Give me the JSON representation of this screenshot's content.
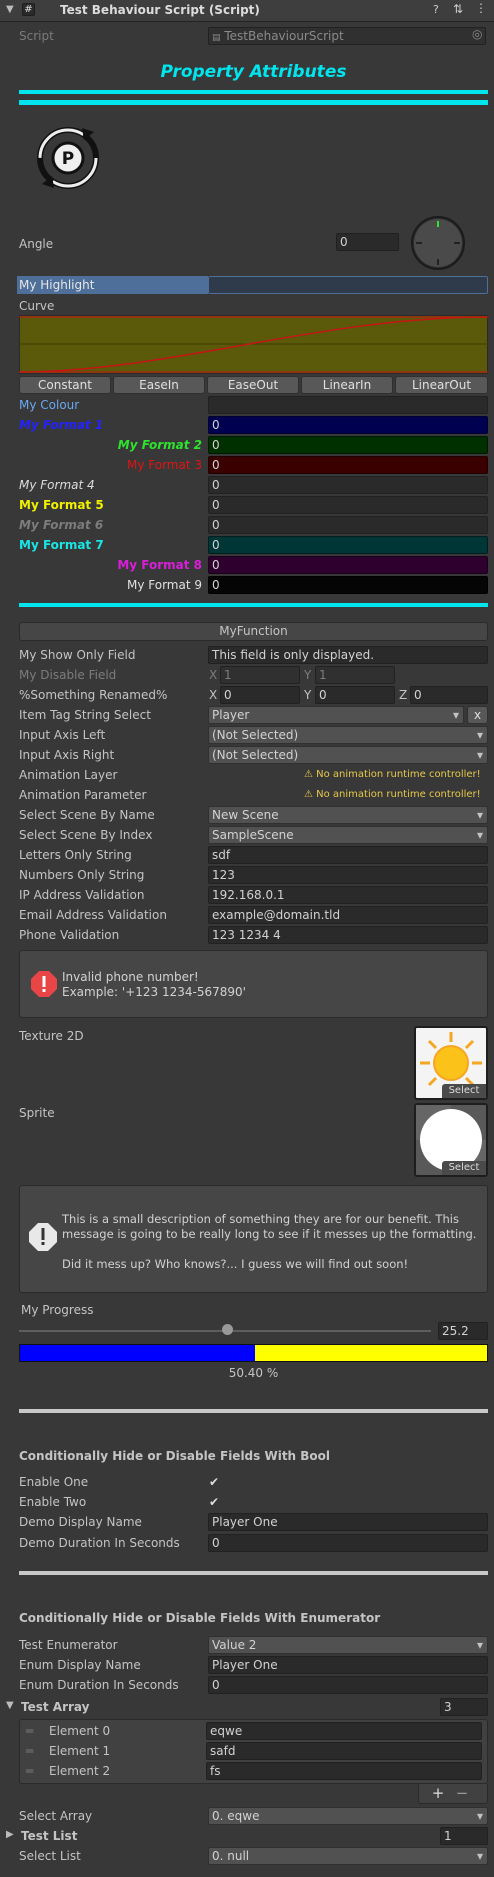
{
  "header": {
    "title": "Test Behaviour Script (Script)"
  },
  "script": {
    "label": "Script",
    "value": "TestBehaviourScript"
  },
  "banner": {
    "title": "Property Attributes"
  },
  "angle": {
    "label": "Angle",
    "value": "0"
  },
  "highlight": {
    "label": "My Highlight"
  },
  "curve": {
    "label": "Curve",
    "presets": [
      "Constant",
      "EaseIn",
      "EaseOut",
      "LinearIn",
      "LinearOut"
    ]
  },
  "colour": {
    "label": "My Colour"
  },
  "formats": [
    {
      "label": "My Format 1",
      "value": "0"
    },
    {
      "label": "My Format 2",
      "value": "0"
    },
    {
      "label": "My Format 3",
      "value": "0"
    },
    {
      "label": "My Format 4",
      "value": "0"
    },
    {
      "label": "My Format 5",
      "value": "0"
    },
    {
      "label": "My Format 6",
      "value": "0"
    },
    {
      "label": "My Format 7",
      "value": "0"
    },
    {
      "label": "My Format 8",
      "value": "0"
    },
    {
      "label": "My Format 9",
      "value": "0"
    }
  ],
  "myfunction": {
    "label": "MyFunction"
  },
  "fields": {
    "show_only": {
      "label": "My Show Only Field",
      "value": "This field is only displayed."
    },
    "disable": {
      "label": "My Disable Field",
      "x_label": "X",
      "x": "1",
      "y_label": "Y",
      "y": "1"
    },
    "renamed": {
      "label": "%Something Renamed%",
      "x_label": "X",
      "x": "0",
      "y_label": "Y",
      "y": "0",
      "z_label": "Z",
      "z": "0"
    },
    "tag": {
      "label": "Item Tag String Select",
      "value": "Player",
      "clear": "x"
    },
    "axis_left": {
      "label": "Input Axis Left",
      "value": "(Not Selected)"
    },
    "axis_right": {
      "label": "Input Axis Right",
      "value": "(Not Selected)"
    },
    "anim_layer": {
      "label": "Animation Layer",
      "value": "No animation runtime controller!"
    },
    "anim_param": {
      "label": "Animation Parameter",
      "value": "No animation runtime controller!"
    },
    "scene_name": {
      "label": "Select Scene By Name",
      "value": "New Scene"
    },
    "scene_index": {
      "label": "Select Scene By Index",
      "value": "SampleScene"
    },
    "letters": {
      "label": "Letters Only String",
      "value": "sdf"
    },
    "numbers": {
      "label": "Numbers Only String",
      "value": "123"
    },
    "ip": {
      "label": "IP Address Validation",
      "value": "192.168.0.1"
    },
    "email": {
      "label": "Email Address Validation",
      "value": "example@domain.tld"
    },
    "phone": {
      "label": "Phone Validation",
      "value": "123 1234 4"
    }
  },
  "phone_error": {
    "line1": "Invalid phone number!",
    "line2": "Example: '+123 1234-567890'"
  },
  "texture": {
    "label": "Texture 2D",
    "select": "Select"
  },
  "sprite": {
    "label": "Sprite",
    "select": "Select"
  },
  "info": {
    "line1": "This is a small description of something they are for our benefit.  This",
    "line2": "message is going to be really long to see if it messes up the formatting.",
    "line3": "Did it mess up?  Who knows?... I guess we will find out soon!"
  },
  "progress": {
    "label": "My Progress",
    "value": "25.2",
    "percent_label": "50.40 %",
    "slider_fraction": 0.504,
    "bar_fraction": 0.504
  },
  "bool_section": {
    "title": "Conditionally Hide or Disable Fields With Bool",
    "enable_one": "Enable One",
    "enable_two": "Enable Two",
    "name_label": "Demo Display Name",
    "name_value": "Player One",
    "dur_label": "Demo Duration In Seconds",
    "dur_value": "0"
  },
  "enum_section": {
    "title": "Conditionally Hide or Disable Fields With Enumerator",
    "enum_label": "Test Enumerator",
    "enum_value": "Value 2",
    "name_label": "Enum Display Name",
    "name_value": "Player One",
    "dur_label": "Enum Duration In Seconds",
    "dur_value": "0"
  },
  "test_array": {
    "label": "Test Array",
    "size": "3",
    "elements": [
      {
        "label": "Element 0",
        "value": "eqwe"
      },
      {
        "label": "Element 1",
        "value": "safd"
      },
      {
        "label": "Element 2",
        "value": "fs"
      }
    ],
    "add": "+",
    "remove": "−"
  },
  "select_array": {
    "label": "Select Array",
    "value": "0. eqwe"
  },
  "test_list": {
    "label": "Test List",
    "size": "1"
  },
  "select_list": {
    "label": "Select List",
    "value": "0. null"
  },
  "colors": {
    "cyan": "#00e5ee",
    "format1": "#2323ff",
    "format2": "#2ee22e",
    "format3": "#e01414",
    "format5": "#f0f000",
    "format7": "#18e6e6",
    "format8": "#d91ed9"
  }
}
